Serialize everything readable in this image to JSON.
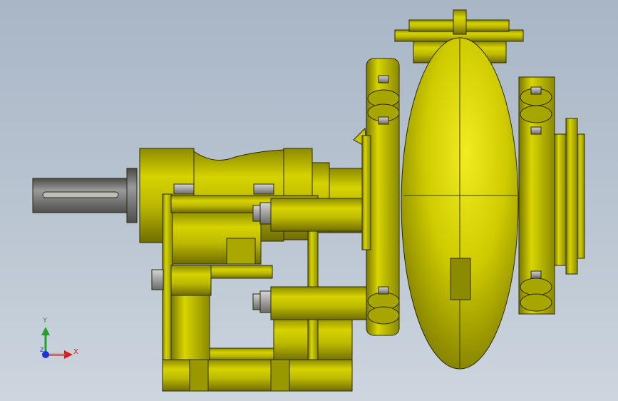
{
  "viewport": {
    "model": "centrifugal-slurry-pump-assembly",
    "render_style": "shaded-with-edges",
    "background_color": "#b5c1cd",
    "part_color": "#c9c600",
    "edge_color": "#2a2a00",
    "shaft_color": "#6e6e6e"
  },
  "triad": {
    "x_label": "X",
    "y_label": "Y",
    "z_label": "Z",
    "x_color": "#d62020",
    "y_color": "#1fa12a",
    "z_color": "#2030d6"
  }
}
